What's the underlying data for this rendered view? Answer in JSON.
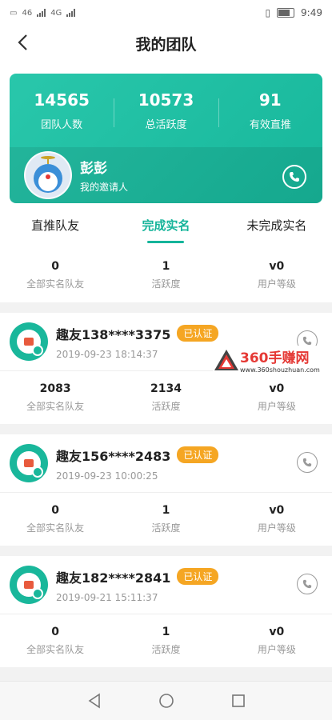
{
  "status_bar": {
    "carrier1": "46",
    "carrier2": "4G",
    "time": "9:49"
  },
  "header": {
    "title": "我的团队"
  },
  "summary_card": {
    "stats": [
      {
        "value": "14565",
        "label": "团队人数"
      },
      {
        "value": "10573",
        "label": "总活跃度"
      },
      {
        "value": "91",
        "label": "有效直推"
      }
    ],
    "inviter": {
      "name": "彭彭",
      "role": "我的邀请人"
    }
  },
  "tabs": [
    {
      "label": "直推队友"
    },
    {
      "label": "完成实名"
    },
    {
      "label": "未完成实名"
    }
  ],
  "overview": [
    {
      "value": "0",
      "label": "全部实名队友"
    },
    {
      "value": "1",
      "label": "活跃度"
    },
    {
      "value": "v0",
      "label": "用户等级"
    }
  ],
  "members": [
    {
      "name": "趣友138****3375",
      "badge": "已认证",
      "time": "2019-09-23 18:14:37",
      "stats": [
        {
          "value": "2083",
          "label": "全部实名队友"
        },
        {
          "value": "2134",
          "label": "活跃度"
        },
        {
          "value": "v0",
          "label": "用户等级"
        }
      ]
    },
    {
      "name": "趣友156****2483",
      "badge": "已认证",
      "time": "2019-09-23 10:00:25",
      "stats": [
        {
          "value": "0",
          "label": "全部实名队友"
        },
        {
          "value": "1",
          "label": "活跃度"
        },
        {
          "value": "v0",
          "label": "用户等级"
        }
      ]
    },
    {
      "name": "趣友182****2841",
      "badge": "已认证",
      "time": "2019-09-21 15:11:37",
      "stats": [
        {
          "value": "0",
          "label": "全部实名队友"
        },
        {
          "value": "1",
          "label": "活跃度"
        },
        {
          "value": "v0",
          "label": "用户等级"
        }
      ]
    }
  ],
  "watermark": {
    "title": "360手赚网",
    "url": "www.360shouzhuan.com"
  },
  "colors": {
    "accent": "#15b49a",
    "badge": "#f5a623"
  }
}
